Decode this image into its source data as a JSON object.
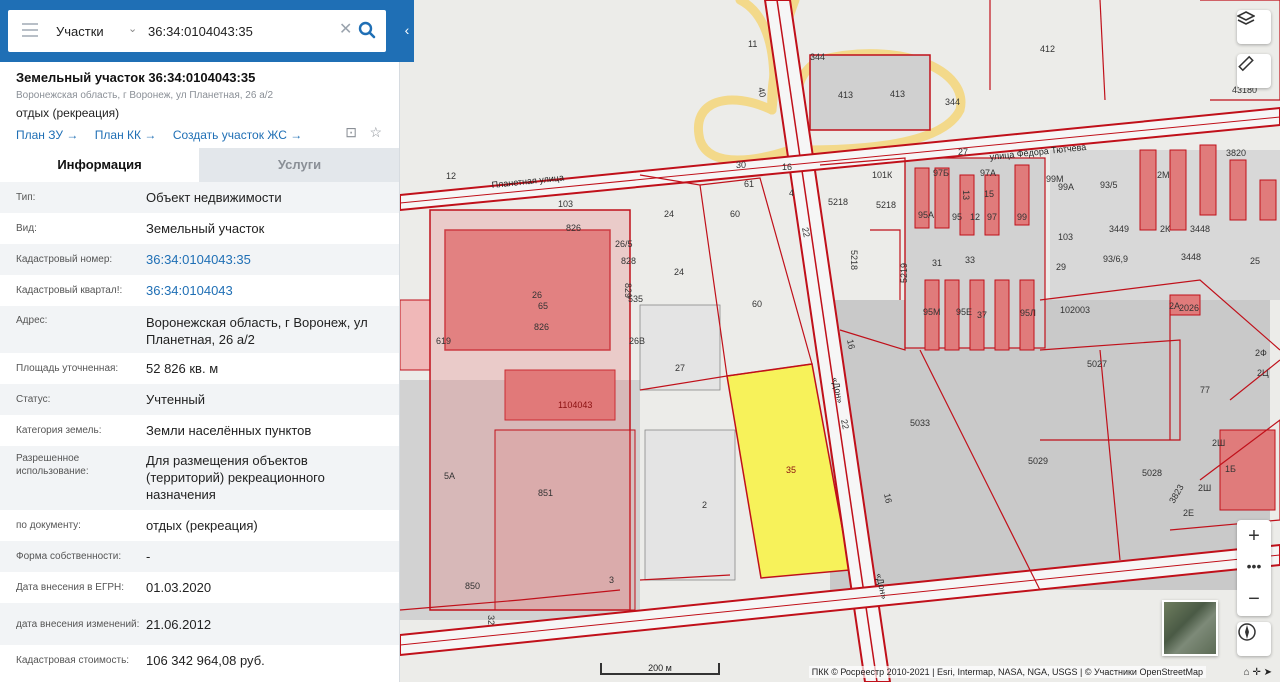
{
  "search": {
    "layer_select": "Участки",
    "query": "36:34:0104043:35"
  },
  "card": {
    "title": "Земельный участок 36:34:0104043:35",
    "address": "Воронежская область, г Воронеж, ул Планетная, 26 а/2",
    "use": "отдых (рекреация)",
    "links": [
      "План ЗУ →",
      "План КК →",
      "Создать участок ЖС →"
    ]
  },
  "tabs": {
    "info": "Информация",
    "services": "Услуги"
  },
  "properties": [
    {
      "label": "Тип:",
      "value": "Объект недвижимости"
    },
    {
      "label": "Вид:",
      "value": "Земельный участок"
    },
    {
      "label": "Кадастровый номер:",
      "value": "36:34:0104043:35"
    },
    {
      "label": "Кадастровый квартал!:",
      "value": "36:34:0104043"
    },
    {
      "label": "Адрес:",
      "value": "Воронежская область, г Воронеж, ул Планетная, 26 а/2"
    },
    {
      "label": "Площадь уточненная:",
      "value": "52 826 кв. м"
    },
    {
      "label": "Статус:",
      "value": "Учтенный"
    },
    {
      "label": "Категория земель:",
      "value": "Земли населённых пунктов"
    },
    {
      "label": "Разрешенное использование:",
      "value": "Для размещения объектов (территорий) рекреационного назначения"
    },
    {
      "label": "по документу:",
      "value": "отдых (рекреация)"
    },
    {
      "label": "Форма собственности:",
      "value": "-"
    },
    {
      "label": "Дата внесения в ЕГРН:",
      "value": "01.03.2020"
    },
    {
      "label": "дата внесения изменений:",
      "value": "21.06.2012"
    },
    {
      "label": "Кадастровая стоимость:",
      "value": "106 342 964,08 руб."
    }
  ],
  "map": {
    "scale_label": "200 м",
    "attribution": "ПКК © Росреестр 2010-2021 | Esri, Intermap, NASA, NGA, USGS | © Участники OpenStreetMap",
    "streets": {
      "planetnaya": "Планетная улица",
      "tyutcheva": "улица Фёдора Тютчева",
      "don_1": "«Дон»",
      "don_2": "«Дон»"
    },
    "parcel_labels": {
      "p412": "412",
      "p43180": "43180",
      "p344a": "344",
      "p344b": "344",
      "p413a": "413",
      "p413b": "413",
      "p11": "11",
      "p40": "40",
      "p12": "12",
      "p30": "30",
      "p27": "27",
      "p61": "61",
      "p16a": "16",
      "p4": "4",
      "p103": "103",
      "p826a": "826",
      "p265": "26/5",
      "p828": "828",
      "p829": "829",
      "p535": "535",
      "p24a": "24",
      "p24b": "24",
      "p60a": "60",
      "p60b": "60",
      "p26": "26",
      "p65": "65",
      "p826b": "826",
      "p619": "619",
      "p26v": "26В",
      "p27b": "27",
      "p104043": "1104043",
      "p5a": "5А",
      "p851": "851",
      "p2": "2",
      "p850": "850",
      "p3": "3",
      "p32": "32",
      "p35": "35",
      "p22a": "22",
      "p22b": "22",
      "p16b": "16",
      "p16c": "16",
      "p101k": "101К",
      "p5218a": "5218",
      "p5218b": "5218",
      "p5218c": "5218",
      "p5219": "5219",
      "p97b": "97Б",
      "p97a": "97А",
      "p13": "13",
      "p15": "15",
      "p95a": "95А",
      "p95": "95",
      "p12b": "12",
      "p97": "97",
      "p99": "99",
      "p31": "31",
      "p33": "33",
      "p29": "29",
      "p103b": "103",
      "p99m": "99М",
      "p99a": "99А",
      "p935": "93/5",
      "p2m": "2М",
      "p3820": "3820",
      "p3449": "3449",
      "p2k": "2К",
      "p3448a": "3448",
      "p3448b": "3448",
      "p9369": "93/6,9",
      "p25": "25",
      "p95m": "95М",
      "p95e": "95Е",
      "p37": "37",
      "p95l": "95Л",
      "p102003": "102003",
      "p2a": "2А",
      "p2026": "2026",
      "p5027": "5027",
      "p77": "77",
      "p5033": "5033",
      "p5029": "5029",
      "p5028": "5028",
      "p2sh": "2Ш",
      "p1b": "1Б",
      "p2sh2": "2Ш",
      "p2e": "2Е",
      "p3823": "3823",
      "p2f": "2Ф",
      "p2ts": "2Ц"
    }
  },
  "colors": {
    "header_blue": "#1f6fb5",
    "selected_parcel": "#f7f25a",
    "parcel_border": "#c0101a",
    "building_fill": "#e06a6a"
  }
}
